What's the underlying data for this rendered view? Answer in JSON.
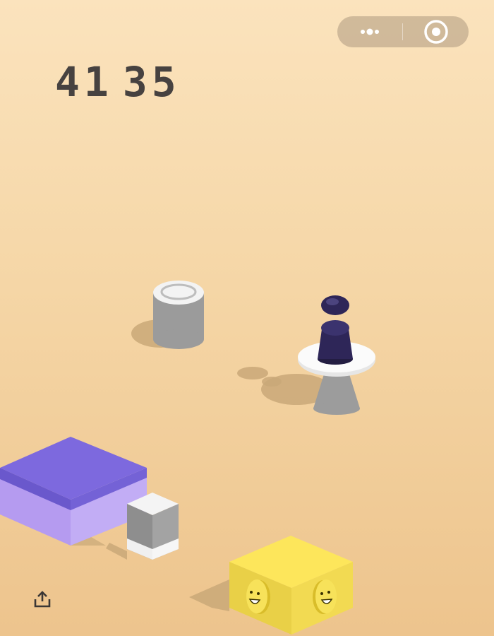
{
  "hud": {
    "score_left": "41",
    "score_right": "35",
    "menu_icon": "more-dots-icon",
    "close_icon": "target-close-icon",
    "share_icon": "share-icon"
  },
  "scene": {
    "player": "dark-navy-pawn",
    "blocks": [
      "purple-slab",
      "small-white-cube",
      "gray-cylinder",
      "white-disc-cone-stand",
      "yellow-smiley-cube"
    ]
  },
  "colors": {
    "background_top": "#fbe3bd",
    "background_bottom": "#edc48d",
    "score": "#474240",
    "player": "#2b2450",
    "purple": "#8d7ae6",
    "yellow": "#fde65b"
  }
}
